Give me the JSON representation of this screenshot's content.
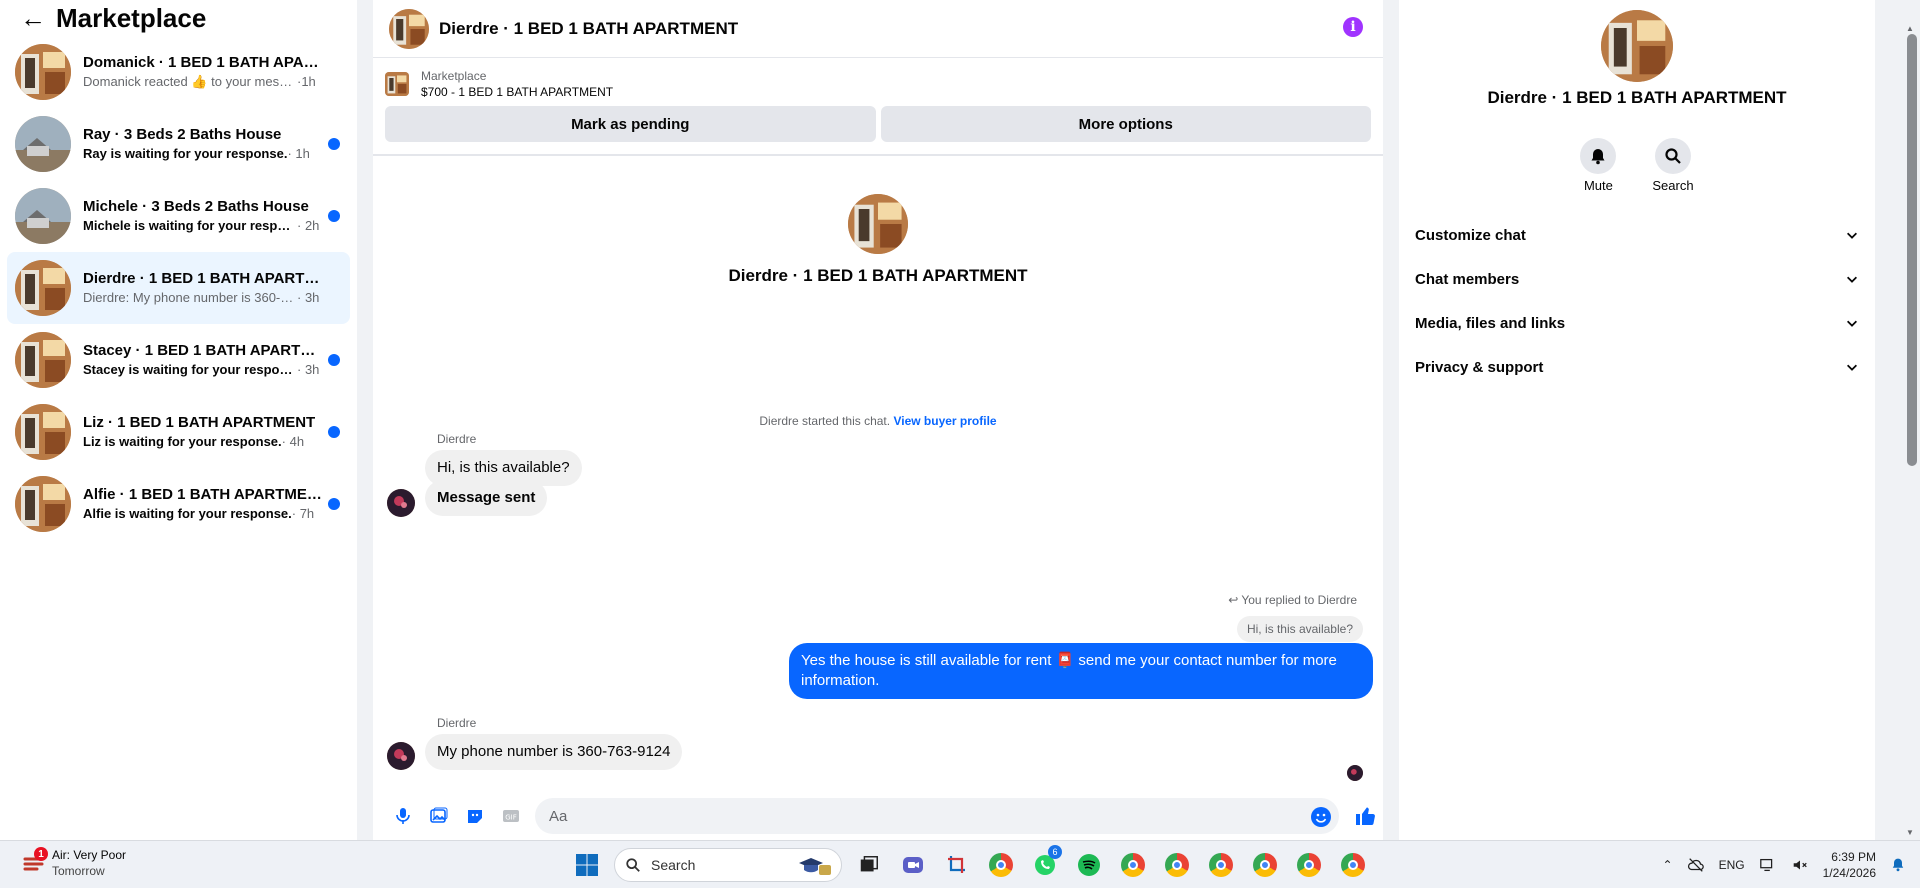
{
  "sidebar": {
    "title": "Marketplace",
    "conversations": [
      {
        "name": "Domanick · 1 BED 1 BATH APARTM...",
        "snippet": "Domanick reacted 👍 to your message",
        "time": "·1h",
        "unread": false,
        "active": false
      },
      {
        "name": "Ray · 3 Beds 2 Baths House",
        "snippet": "Ray is waiting for your response.",
        "time": "· 1h",
        "unread": true,
        "active": false
      },
      {
        "name": "Michele · 3 Beds 2 Baths House",
        "snippet": "Michele is waiting for your respon...",
        "time": "· 2h",
        "unread": true,
        "active": false
      },
      {
        "name": "Dierdre · 1 BED 1 BATH APARTMENT",
        "snippet": "Dierdre: My phone number is 360-76...",
        "time": "· 3h",
        "unread": false,
        "active": true
      },
      {
        "name": "Stacey · 1 BED 1 BATH APARTMENT",
        "snippet": "Stacey is waiting for your response.",
        "time": "· 3h",
        "unread": true,
        "active": false
      },
      {
        "name": "Liz · 1 BED 1 BATH APARTMENT",
        "snippet": "Liz is waiting for your response.",
        "time": "· 4h",
        "unread": true,
        "active": false
      },
      {
        "name": "Alfie · 1 BED 1 BATH APARTMENT",
        "snippet": "Alfie is waiting for your response.",
        "time": "· 7h",
        "unread": true,
        "active": false
      }
    ]
  },
  "chat": {
    "title": "Dierdre · 1 BED 1 BATH APARTMENT",
    "listing": {
      "category": "Marketplace",
      "price_title": "$700 - 1 BED 1 BATH APARTMENT",
      "mark_pending": "Mark as pending",
      "more_options": "More options"
    },
    "intro_name": "Dierdre · 1 BED 1 BATH APARTMENT",
    "started_text": "Dierdre started this chat.",
    "view_profile": "View buyer profile",
    "messages": {
      "m1_sender": "Dierdre",
      "m1_text": "Hi, is this available?",
      "m2_text": "Message sent",
      "replied_label": "You replied to Dierdre",
      "quoted": "Hi, is this available?",
      "out_text": "Yes the house is still available for rent 📮 send me your contact number for more information.",
      "m3_sender": "Dierdre",
      "m3_text": "My phone number is 360-763-9124"
    },
    "composer_placeholder": "Aa"
  },
  "details": {
    "name": "Dierdre · 1 BED 1 BATH APARTMENT",
    "mute": "Mute",
    "search": "Search",
    "sections": [
      "Customize chat",
      "Chat members",
      "Media, files and links",
      "Privacy & support"
    ]
  },
  "taskbar": {
    "weather_title": "Air: Very Poor",
    "weather_sub": "Tomorrow",
    "weather_badge": "1",
    "search_label": "Search",
    "whatsapp_badge": "6",
    "lang": "ENG",
    "time": "6:39 PM",
    "date": "1/24/2026"
  },
  "colors": {
    "accent": "#0866ff",
    "info": "#a033ff",
    "active_row": "#ebf5ff",
    "bubble_in": "#f0f0f0"
  }
}
